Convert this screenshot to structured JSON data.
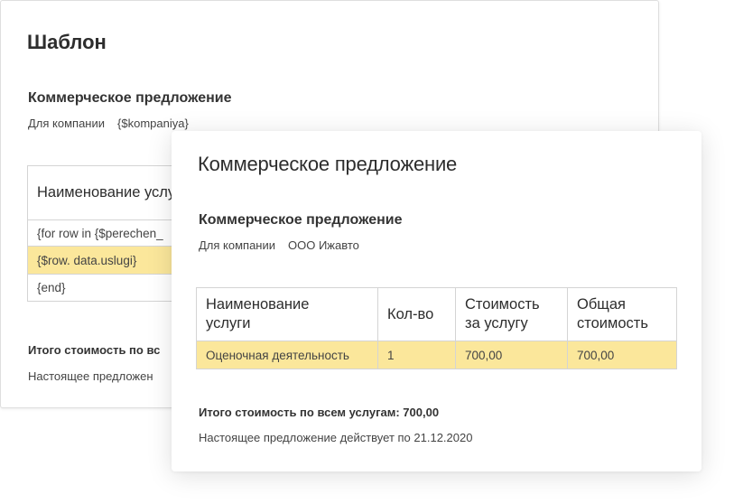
{
  "template_card": {
    "title": "Шаблон",
    "doc_title": "Коммерческое предложение",
    "company_label": "Для компании",
    "company_value": "{$kompaniya}",
    "table": {
      "header": "Наименование услуги",
      "rows": [
        "{for row in {$perechen_",
        "{$row. data.uslugi}",
        "{end}"
      ]
    },
    "total_text": "Итого стоимость по вс",
    "validity_text": "Настоящее предложен"
  },
  "result_card": {
    "title": "Коммерческое предложение",
    "doc_title": "Коммерческое предложение",
    "company_label": "Для компании",
    "company_value": "ООО Ижавто",
    "table": {
      "headers": [
        "Наименование услуги",
        "Кол-во",
        "Стоимость за услугу",
        "Общая стоимость"
      ],
      "rows": [
        [
          "Оценочная деятельность",
          "1",
          "700,00",
          "700,00"
        ]
      ]
    },
    "total_text": "Итого стоимость по всем услугам: 700,00",
    "validity_text": "Настоящее предложение действует по 21.12.2020"
  },
  "colors": {
    "highlight": "#fbe79b",
    "border": "#d4d4d4"
  }
}
